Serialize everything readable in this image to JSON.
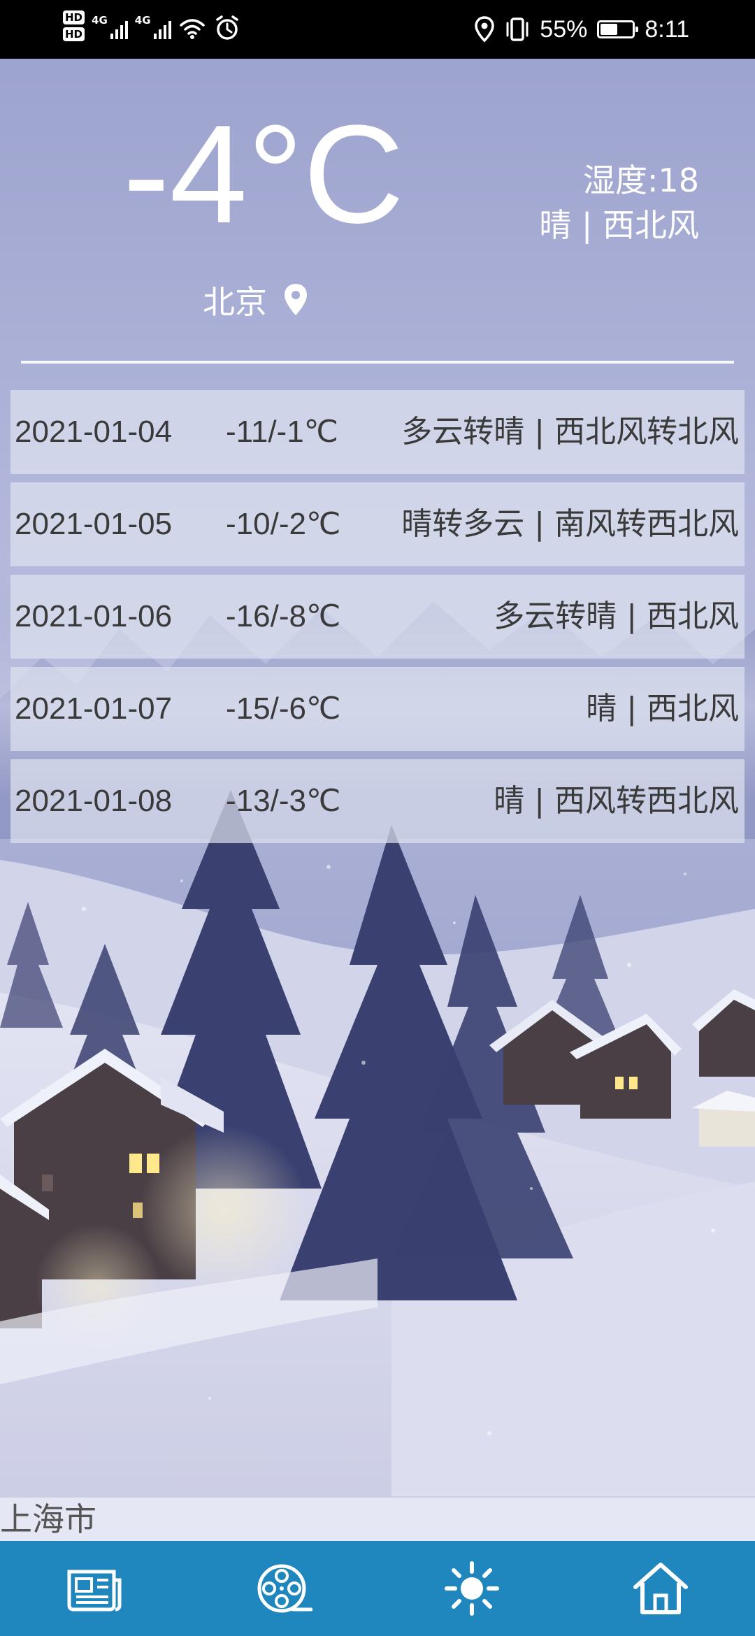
{
  "status_bar": {
    "hd1": "HD",
    "hd2": "HD",
    "net1": "4G",
    "net2": "4G",
    "battery_percent": "55%",
    "battery_level": 0.55,
    "time": "8:11",
    "icons": [
      "location-icon",
      "vibrate-icon",
      "wifi-icon",
      "alarm-icon",
      "battery-icon"
    ]
  },
  "current": {
    "temperature": "-4°C",
    "humidity": "湿度:18",
    "condition": "晴 | 西北风",
    "city": "北京",
    "city_icon": "location-pin-icon"
  },
  "forecast": [
    {
      "date": "2021-01-04",
      "range": "-11/-1℃",
      "desc": "多云转晴 | 西北风转北风"
    },
    {
      "date": "2021-01-05",
      "range": "-10/-2℃",
      "desc": "晴转多云 | 南风转西北风"
    },
    {
      "date": "2021-01-06",
      "range": "-16/-8℃",
      "desc": "多云转晴 | 西北风"
    },
    {
      "date": "2021-01-07",
      "range": "-15/-6℃",
      "desc": "晴 | 西北风"
    },
    {
      "date": "2021-01-08",
      "range": "-13/-3℃",
      "desc": "晴 | 西风转西北风"
    }
  ],
  "bottom_city": "上海市",
  "nav": {
    "items": [
      "news-icon",
      "film-reel-icon",
      "sun-icon",
      "home-icon"
    ],
    "background": "#1f87bd"
  }
}
